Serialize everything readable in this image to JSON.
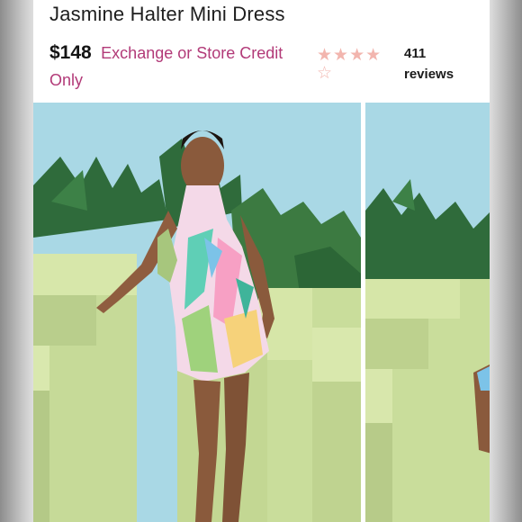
{
  "product": {
    "title": "Jasmine Halter Mini Dress",
    "price": "$148",
    "credit_line_1": "Exchange or Store Credit",
    "credit_line_2": "Only"
  },
  "rating": {
    "stars_filled": 4,
    "stars_total": 5,
    "review_count": "411",
    "review_label": "reviews"
  },
  "gallery": {
    "images": [
      "main-photo",
      "next-photo"
    ],
    "icons": {
      "star": "star-icon",
      "star_empty": "star-outline-icon"
    }
  },
  "colors": {
    "accent": "#b23a78",
    "star": "#f2b5ae",
    "sky": "#a9d8e5",
    "set_green": "#c9dd9b"
  }
}
